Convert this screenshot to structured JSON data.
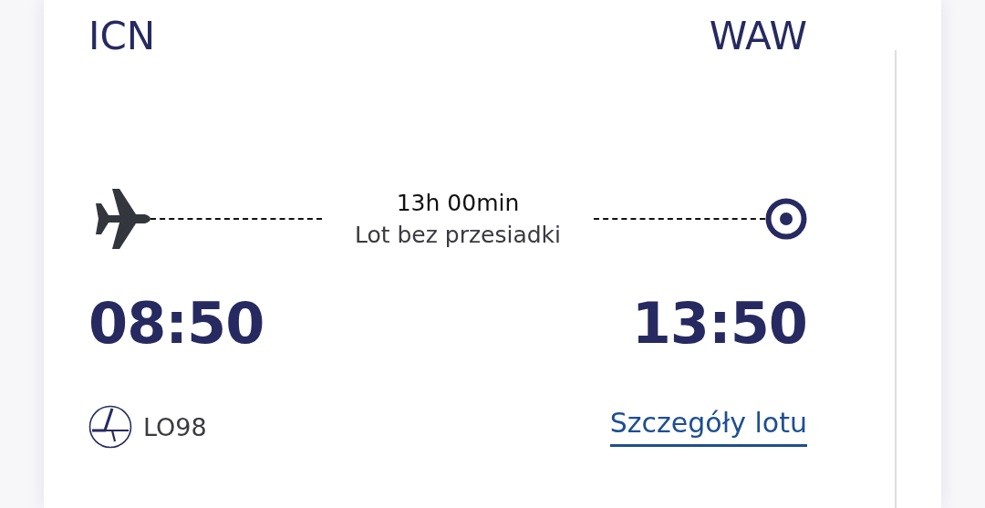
{
  "origin": {
    "code": "ICN",
    "time": "08:50"
  },
  "destination": {
    "code": "WAW",
    "time": "13:50"
  },
  "duration": "13h 00min",
  "stops": "Lot bez przesiadki",
  "flight_number": "LO98",
  "details_link": "Szczegóły lotu"
}
